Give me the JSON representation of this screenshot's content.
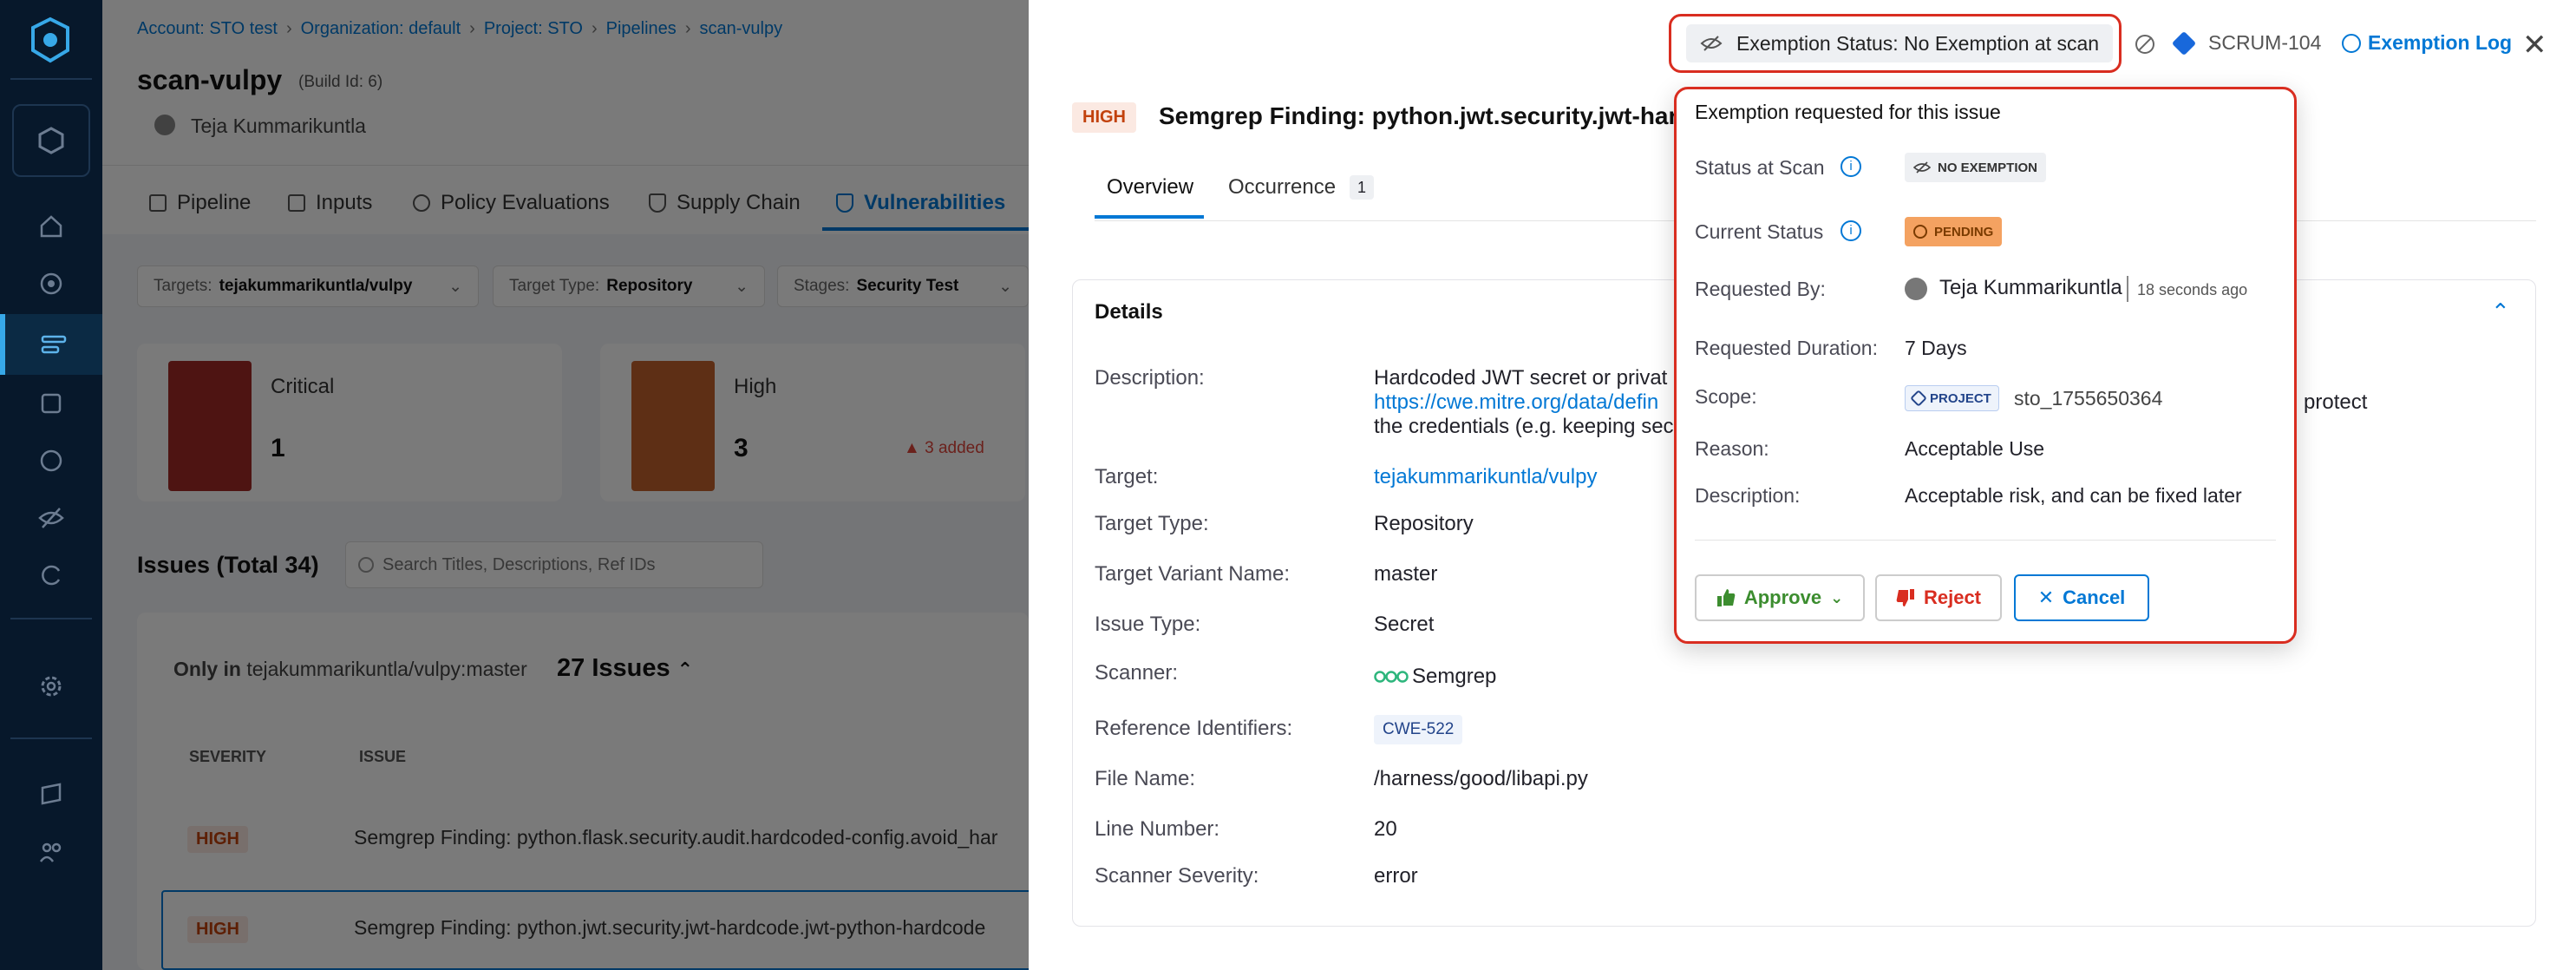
{
  "nav": {
    "items": [
      "home",
      "deployments",
      "pipelines",
      "security-tests",
      "builds",
      "cost",
      "exemptions",
      "chaos",
      "settings",
      "docs",
      "users"
    ]
  },
  "breadcrumb": [
    "Account: STO test",
    "Organization: default",
    "Project: STO",
    "Pipelines",
    "scan-vulpy"
  ],
  "pipeline": {
    "title": "scan-vulpy",
    "build_id": "(Build Id: 6)",
    "user": "Teja Kummarikuntla"
  },
  "tabs": [
    "Pipeline",
    "Inputs",
    "Policy Evaluations",
    "Supply Chain",
    "Vulnerabilities"
  ],
  "filters": [
    {
      "key": "Targets:",
      "value": "tejakummarikuntla/vulpy"
    },
    {
      "key": "Target Type:",
      "value": "Repository"
    },
    {
      "key": "Stages:",
      "value": "Security Test"
    }
  ],
  "severity_cards": [
    {
      "label": "Critical",
      "count": "1",
      "delta": "",
      "color": "#a32a26"
    },
    {
      "label": "High",
      "count": "3",
      "delta": "3 added",
      "color": "#c4622d"
    }
  ],
  "issues": {
    "title": "Issues (Total 34)",
    "search_placeholder": "Search Titles, Descriptions, Ref IDs",
    "group_prefix": "Only in",
    "group_target": "tejakummarikuntla/vulpy:master",
    "group_count": "27 Issues",
    "col_severity": "SEVERITY",
    "col_issue": "ISSUE",
    "rows": [
      {
        "severity": "HIGH",
        "title": "Semgrep Finding: python.flask.security.audit.hardcoded-config.avoid_har"
      },
      {
        "severity": "HIGH",
        "title": "Semgrep Finding: python.jwt.security.jwt-hardcode.jwt-python-hardcode"
      }
    ]
  },
  "drawer": {
    "severity": "HIGH",
    "title": "Semgrep Finding: python.jwt.security.jwt-hardco",
    "exemption_status": "Exemption Status: No Exemption at scan",
    "ticket": "SCRUM-104",
    "exemption_log": "Exemption Log",
    "tabs": {
      "overview": "Overview",
      "occurrence": "Occurrence",
      "occurrence_count": "1"
    },
    "details_title": "Details",
    "description_label": "Description:",
    "description_line1": "Hardcoded JWT secret or privat",
    "description_link": "https://cwe.mitre.org/data/defin",
    "description_line3": "the credentials (e.g. keeping sec",
    "description_tail": "protect",
    "fields": [
      {
        "label": "Target:",
        "value": "tejakummarikuntla/vulpy"
      },
      {
        "label": "Target Type:",
        "value": "Repository"
      },
      {
        "label": "Target Variant Name:",
        "value": "master"
      },
      {
        "label": "Issue Type:",
        "value": "Secret"
      },
      {
        "label": "Scanner:",
        "value": "Semgrep"
      },
      {
        "label": "Reference Identifiers:",
        "value": "CWE-522"
      },
      {
        "label": "File Name:",
        "value": "/harness/good/libapi.py"
      },
      {
        "label": "Line Number:",
        "value": "20"
      },
      {
        "label": "Scanner Severity:",
        "value": "error"
      }
    ]
  },
  "popover": {
    "title": "Exemption requested for this issue",
    "status_at_scan_label": "Status at Scan",
    "status_at_scan_value": "NO EXEMPTION",
    "current_status_label": "Current Status",
    "current_status_value": "PENDING",
    "requested_by_label": "Requested By:",
    "requested_by_value": "Teja Kummarikuntla",
    "requested_time": "18 seconds ago",
    "duration_label": "Requested Duration:",
    "duration_value": "7 Days",
    "scope_label": "Scope:",
    "scope_badge": "PROJECT",
    "scope_value": "sto_1755650364",
    "reason_label": "Reason:",
    "reason_value": "Acceptable Use",
    "description_label": "Description:",
    "description_value": "Acceptable risk, and can be fixed later",
    "approve": "Approve",
    "reject": "Reject",
    "cancel": "Cancel"
  },
  "colors": {
    "nav_bg": "#07182b",
    "link": "#0278d5",
    "danger": "#d92d20",
    "pending": "#f4a261",
    "approve": "#3c8d2f"
  }
}
